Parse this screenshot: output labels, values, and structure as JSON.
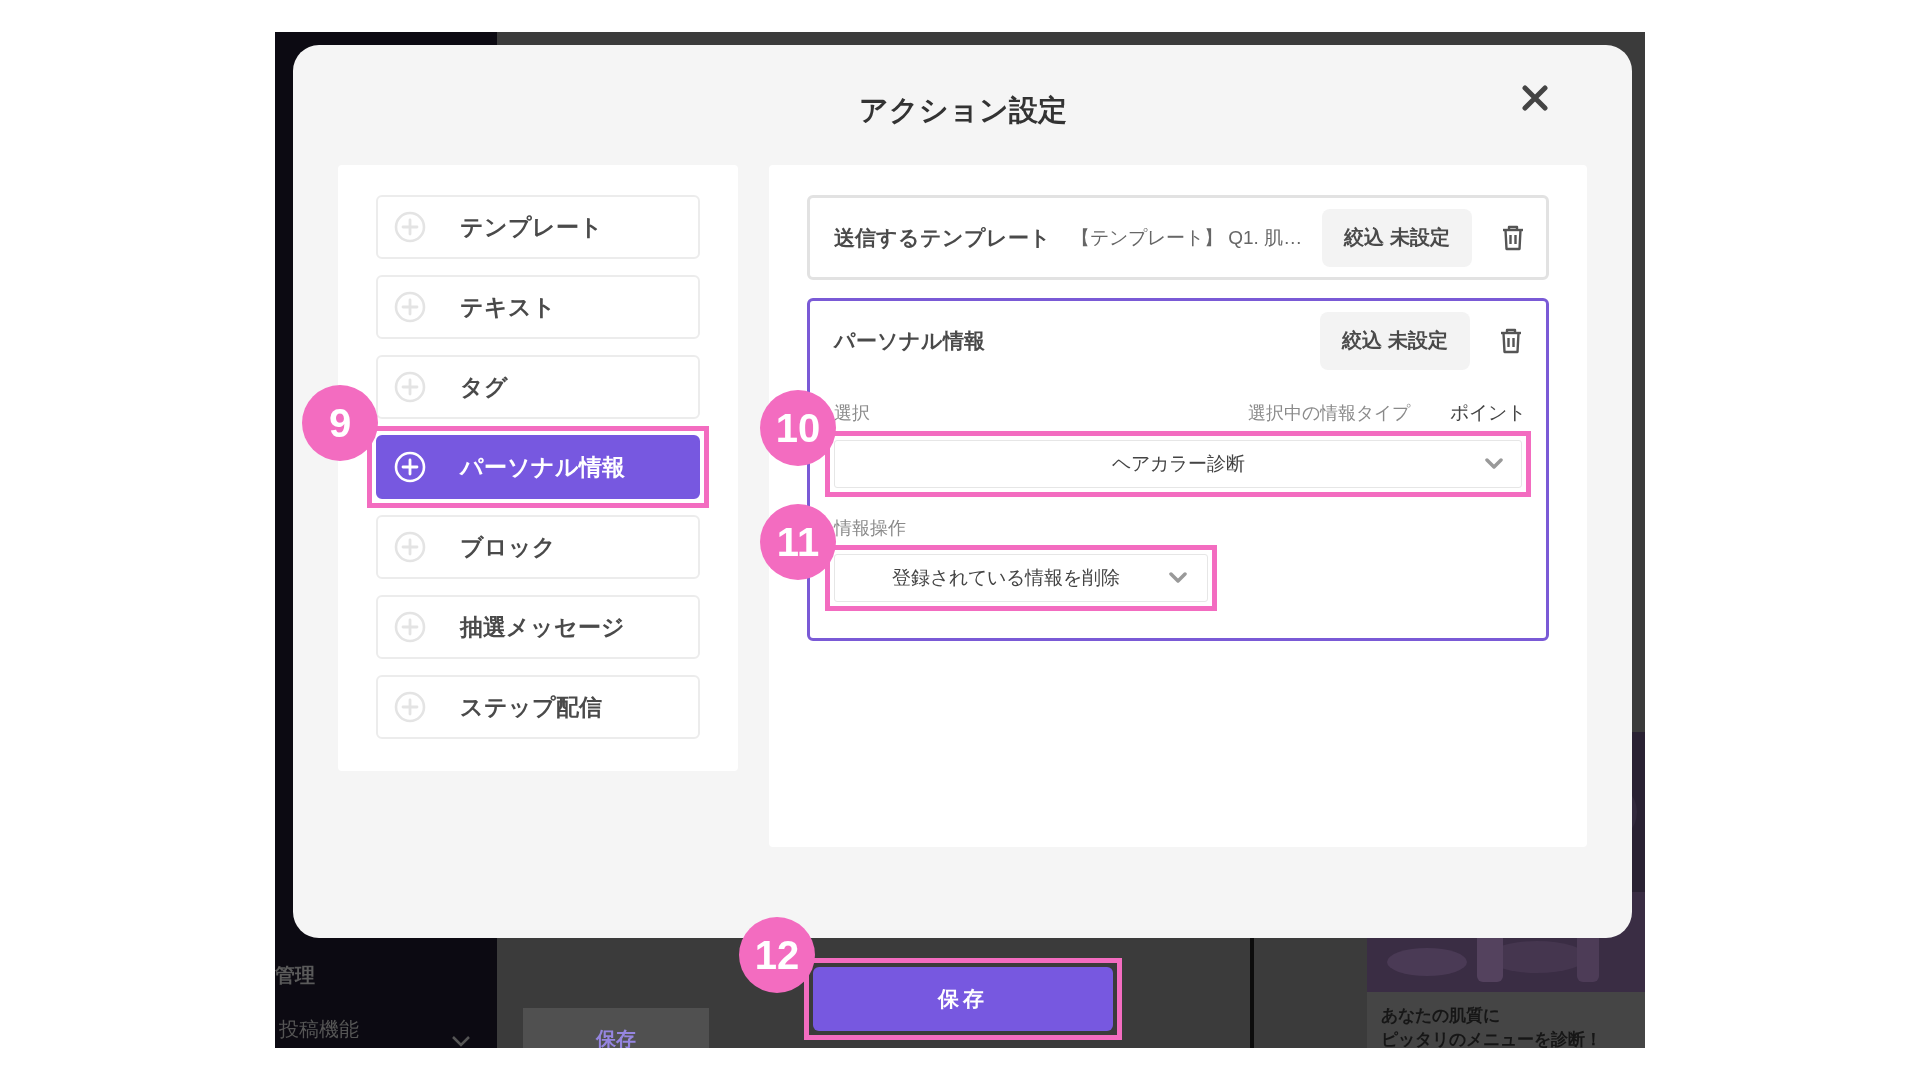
{
  "background": {
    "sidebar": [
      "管理",
      "投稿機能"
    ],
    "save_button": "保存",
    "card_text": [
      "あなたの肌質に",
      "ピッタリのメニューを診断！"
    ]
  },
  "dialog": {
    "title": "アクション設定"
  },
  "action_types": [
    {
      "label": "テンプレート",
      "selected": false
    },
    {
      "label": "テキスト",
      "selected": false
    },
    {
      "label": "タグ",
      "selected": false
    },
    {
      "label": "パーソナル情報",
      "selected": true,
      "callout": "9"
    },
    {
      "label": "ブロック",
      "selected": false
    },
    {
      "label": "抽選メッセージ",
      "selected": false
    },
    {
      "label": "ステップ配信",
      "selected": false
    }
  ],
  "actions": [
    {
      "kind": "template",
      "selected": false,
      "title": "送信するテンプレート",
      "value": "【テンプレート】 Q1. 肌…",
      "filter_button": "絞込 未設定"
    },
    {
      "kind": "personal",
      "selected": true,
      "title": "パーソナル情報",
      "filter_button": "絞込 未設定",
      "select_label": "選択",
      "type_label": "選択中の情報タイプ",
      "type_value": "ポイント",
      "select_value": "ヘアカラー診断",
      "select_callout": "10",
      "operation_label": "情報操作",
      "operation_value": "登録されている情報を削除",
      "operation_callout": "11"
    }
  ],
  "save_button": {
    "label": "保存",
    "callout": "12"
  }
}
